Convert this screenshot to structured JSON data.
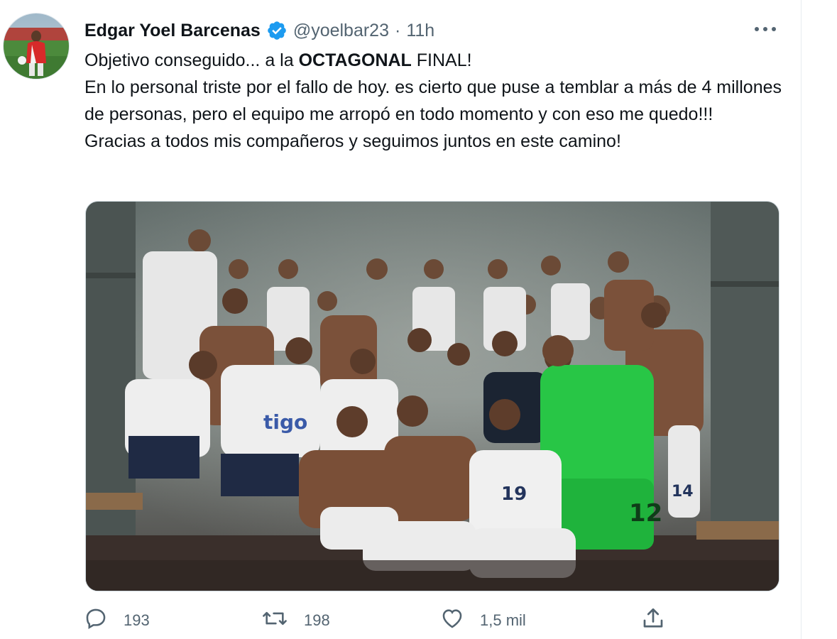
{
  "tweet": {
    "author_name": "Edgar Yoel Barcenas",
    "handle": "@yoelbar23",
    "separator": "·",
    "time": "11h",
    "text_line1_prefix": "Objetivo conseguido... a la ",
    "text_line1_bold": "OCTAGONAL",
    "text_line1_suffix": " FINAL!",
    "text_line2": "En lo personal triste por el fallo de hoy. es cierto que puse a temblar a más de 4 millones de personas, pero el equipo me arropó en todo momento y con eso me quedo!!!",
    "text_line3": "Gracias a todos mis compañeros  y seguimos juntos en este camino!"
  },
  "actions": {
    "reply_count": "193",
    "retweet_count": "198",
    "like_count": "1,5 mil"
  },
  "icons": {
    "verified": "verified-badge-icon",
    "more": "more-options-icon",
    "reply": "reply-icon",
    "retweet": "retweet-icon",
    "like": "heart-icon",
    "share": "share-icon"
  },
  "colors": {
    "verified_blue": "#1d9bf0",
    "secondary_text": "#536471",
    "primary_text": "#0f1419"
  }
}
